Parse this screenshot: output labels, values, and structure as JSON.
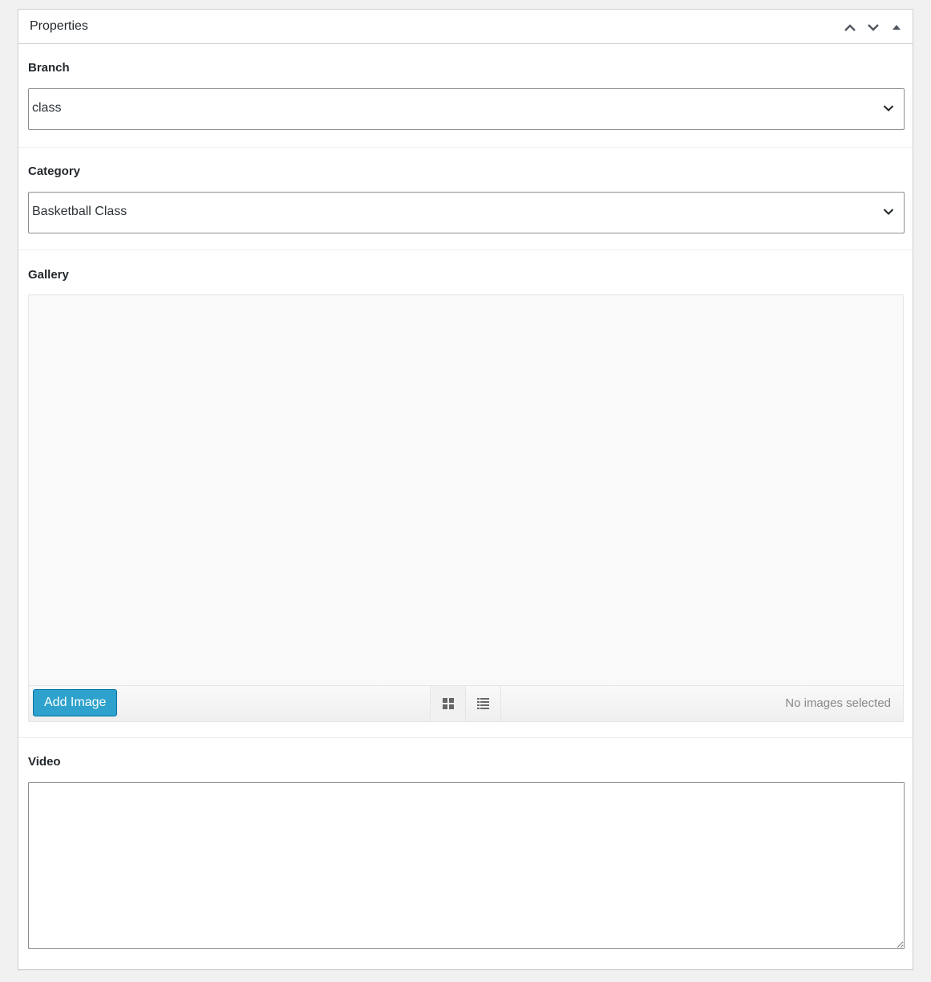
{
  "metabox": {
    "title": "Properties",
    "actions": [
      {
        "name": "move-up",
        "icon": "chevron-up-icon"
      },
      {
        "name": "move-down",
        "icon": "chevron-down-icon"
      },
      {
        "name": "toggle-panel",
        "icon": "triangle-up-icon"
      }
    ]
  },
  "fields": {
    "branch": {
      "label": "Branch",
      "value": "class"
    },
    "category": {
      "label": "Category",
      "value": "Basketball Class"
    },
    "gallery": {
      "label": "Gallery",
      "add_button": "Add Image",
      "status": "No images selected",
      "views": [
        "grid-view-icon",
        "list-view-icon"
      ]
    },
    "video": {
      "label": "Video",
      "value": ""
    }
  },
  "colors": {
    "accent": "#2ea2cc",
    "border": "#ccd0d4",
    "page_bg": "#f1f1f1"
  }
}
